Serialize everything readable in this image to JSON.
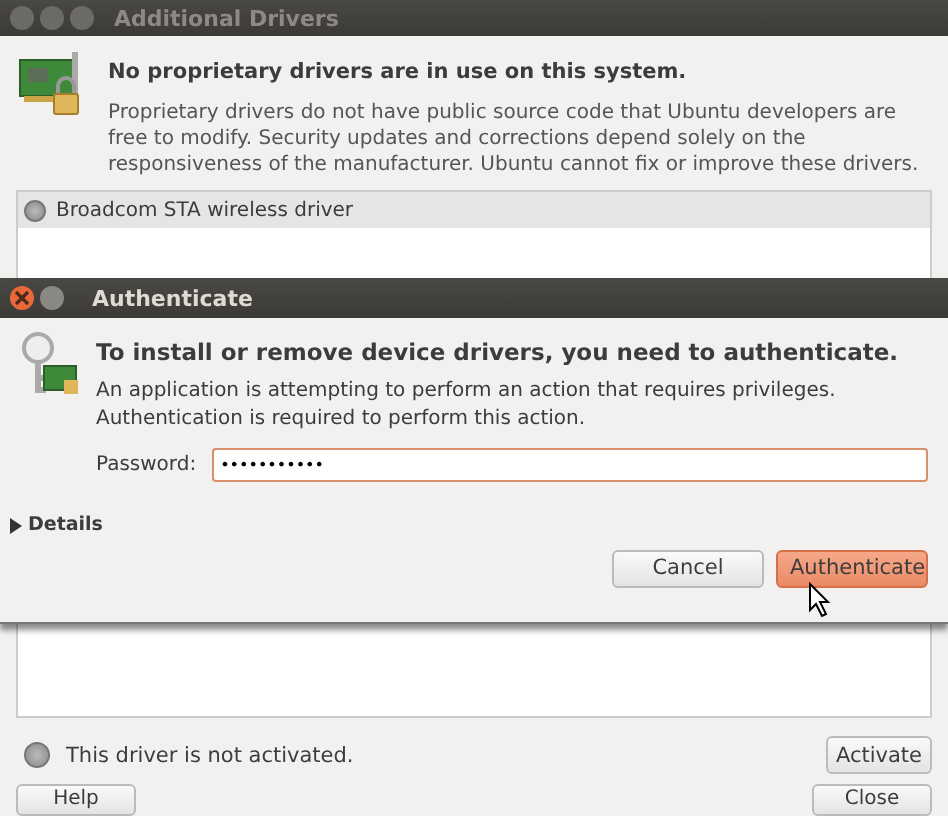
{
  "window": {
    "title": "Additional Drivers"
  },
  "header": {
    "title": "No proprietary drivers are in use on this system.",
    "text": "Proprietary drivers do not have public source code that Ubuntu developers are free to modify. Security updates and corrections depend solely on the responsiveness of the manufacturer. Ubuntu cannot fix or improve these drivers."
  },
  "drivers": [
    {
      "name": "Broadcom STA wireless driver"
    }
  ],
  "status": {
    "text": "This driver is not activated.",
    "button": "Activate"
  },
  "buttons": [
    "Help",
    "Close"
  ],
  "dialog": {
    "title": "Authenticate",
    "heading": "To install or remove device drivers, you need to authenticate.",
    "text": "An application is attempting to perform an action that requires privileges. Authentication is required to perform this action.",
    "password_label": "Password:",
    "password_value": "•••••••••••",
    "details": {
      "label": "Details",
      "expanded": false
    },
    "buttons": [
      {
        "label": "Cancel",
        "default": false
      },
      {
        "label": "Authenticate",
        "default": true
      }
    ]
  }
}
